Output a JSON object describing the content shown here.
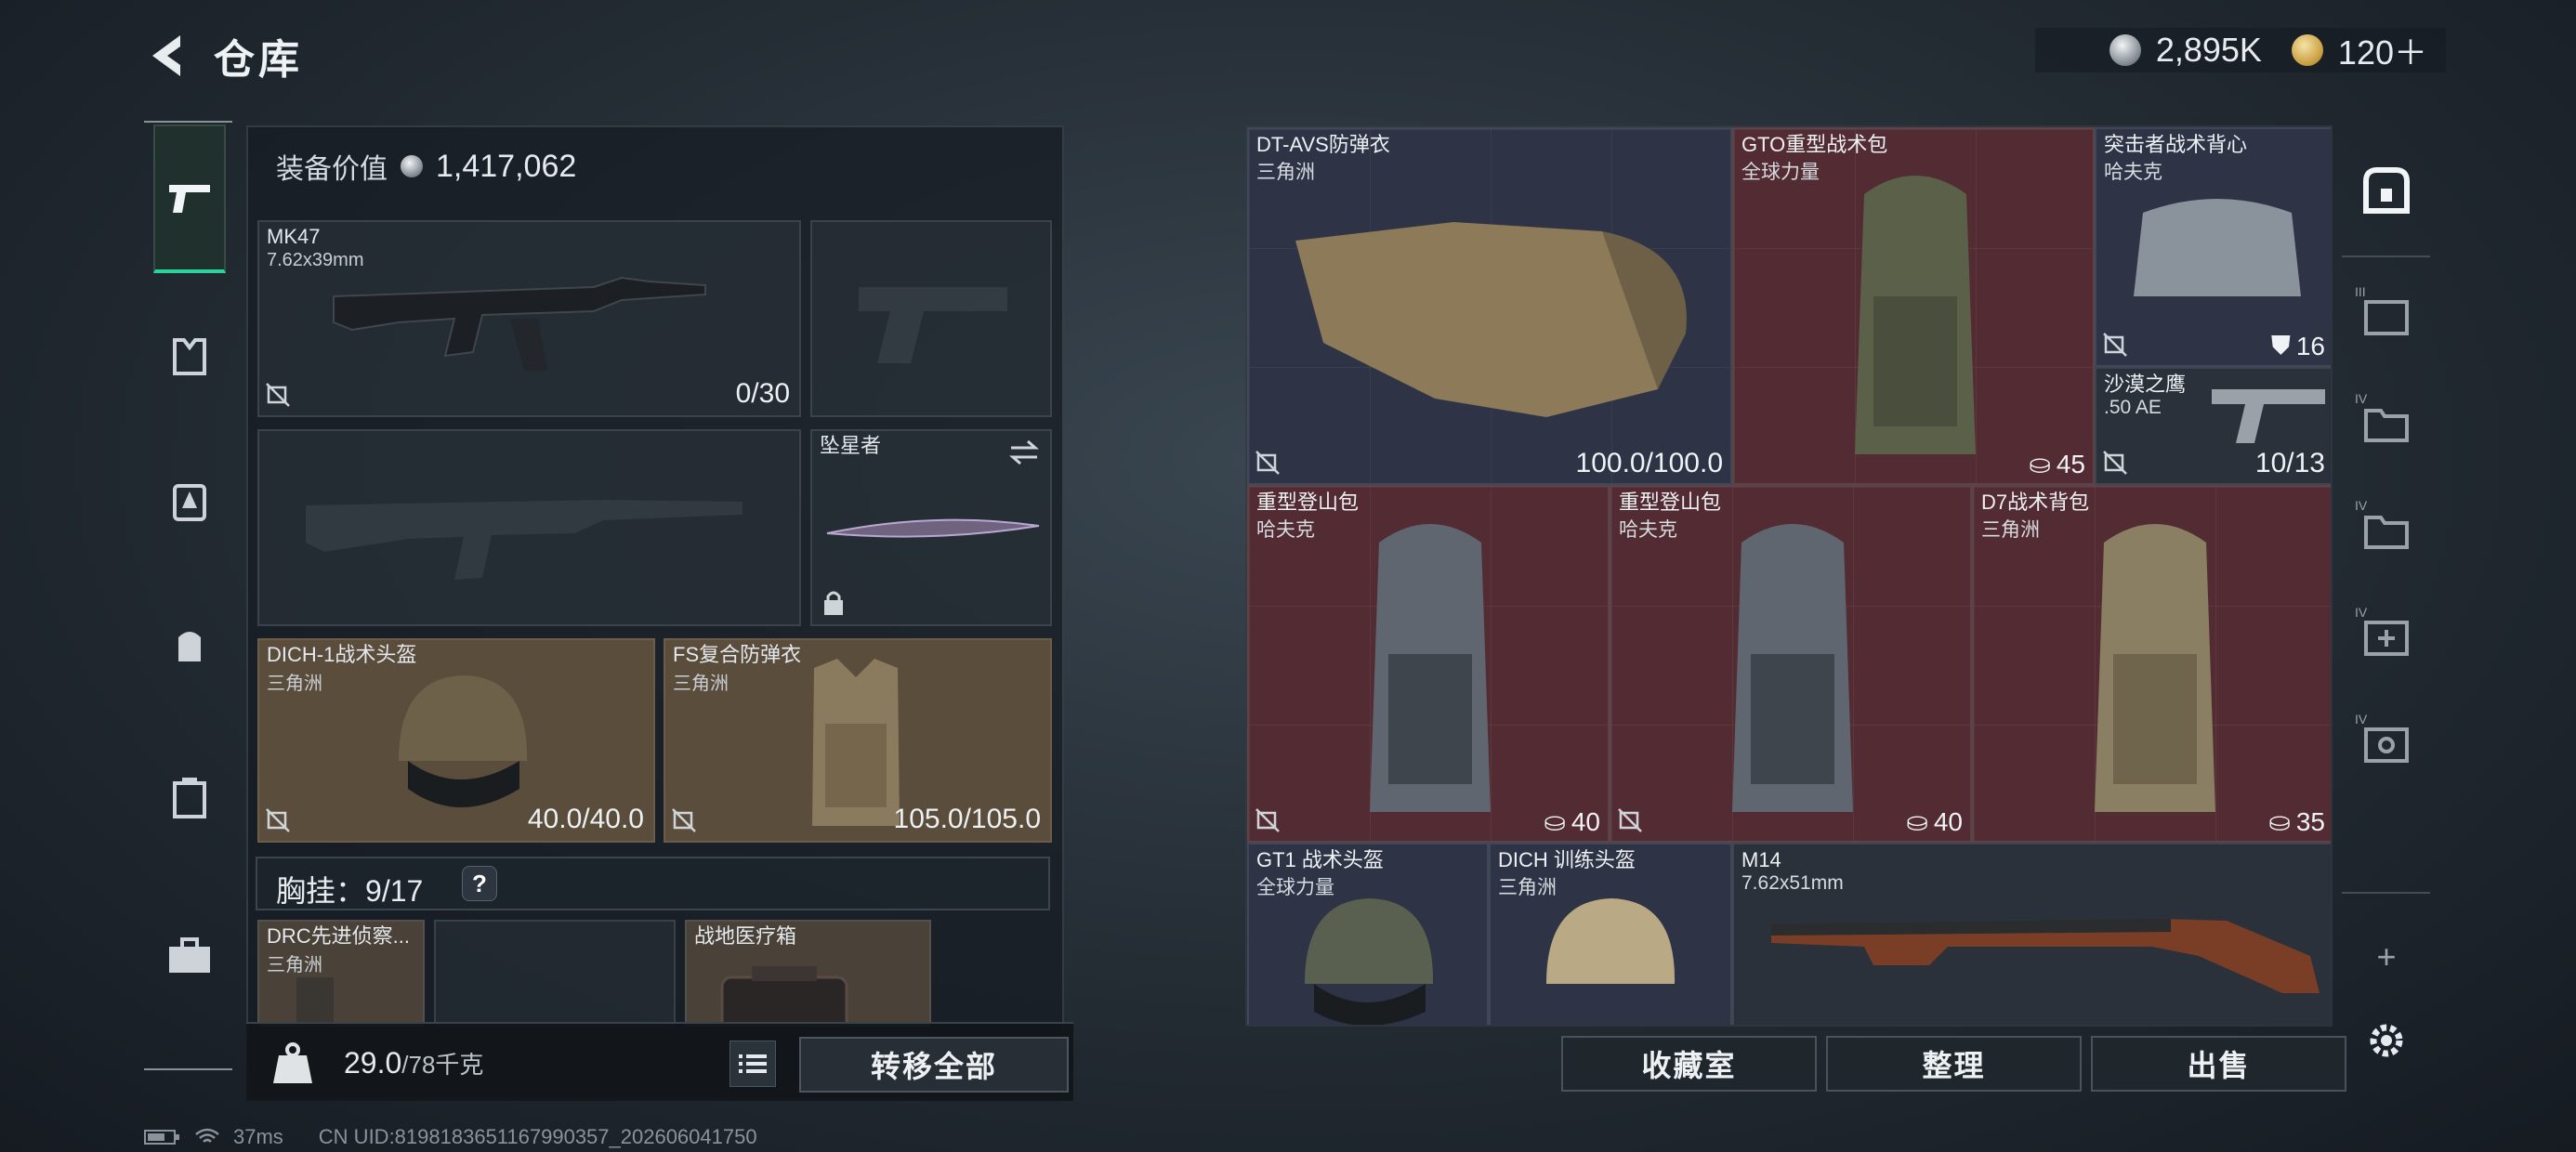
{
  "header": {
    "title": "仓库",
    "coin_amount": "2,895K",
    "ticket_amount": "120＋"
  },
  "left_panel": {
    "equip_value_label": "装备价值",
    "equip_value": "1,417,062",
    "primary_weapon": {
      "name": "MK47",
      "caliber": "7.62x39mm",
      "ammo": "0/30"
    },
    "melee": {
      "name": "坠星者"
    },
    "helmet": {
      "name": "DICH-1战术头盔",
      "brand": "三角洲",
      "durability": "40.0/40.0"
    },
    "armor": {
      "name": "FS复合防弹衣",
      "brand": "三角洲",
      "durability": "105.0/105.0"
    },
    "chest_rig": {
      "label": "胸挂：",
      "capacity": "9/17",
      "help": "?"
    },
    "chest_items": [
      {
        "name": "DRC先进侦察...",
        "brand": "三角洲"
      },
      {
        "name": "战地医疗箱"
      }
    ]
  },
  "weight": {
    "current": "29.0",
    "max": "/78千克"
  },
  "buttons": {
    "transfer_all": "转移全部",
    "collection": "收藏室",
    "organize": "整理",
    "sell": "出售"
  },
  "storage_items": [
    {
      "name": "DT-AVS防弹衣",
      "brand": "三角洲",
      "value": "100.0/100.0"
    },
    {
      "name": "GTO重型战术包",
      "brand": "全球力量",
      "badge": "45"
    },
    {
      "name": "突击者战术背心",
      "brand": "哈夫克",
      "badge": "16"
    },
    {
      "name": "沙漠之鹰",
      "brand": ".50 AE",
      "value": "10/13"
    },
    {
      "name": "重型登山包",
      "brand": "哈夫克",
      "badge": "40"
    },
    {
      "name": "重型登山包",
      "brand": "哈夫克",
      "badge": "40"
    },
    {
      "name": "D7战术背包",
      "brand": "三角洲",
      "badge": "35"
    },
    {
      "name": "GT1 战术头盔",
      "brand": "全球力量"
    },
    {
      "name": "DICH 训练头盔",
      "brand": "三角洲"
    },
    {
      "name": "M14",
      "brand": "7.62x51mm"
    }
  ],
  "right_rail": {
    "tab_labels": [
      "III",
      "IV",
      "IV",
      "IV",
      "IV"
    ],
    "add": "+"
  },
  "status": {
    "ping": "37ms",
    "uid": "CN UID:8198183651167990357_202606041750"
  },
  "colors": {
    "accent_green": "#2bd29a",
    "red_tile": "#532c33",
    "blue_tile": "#2e3346",
    "brown_slot": "#5b4d3c"
  }
}
